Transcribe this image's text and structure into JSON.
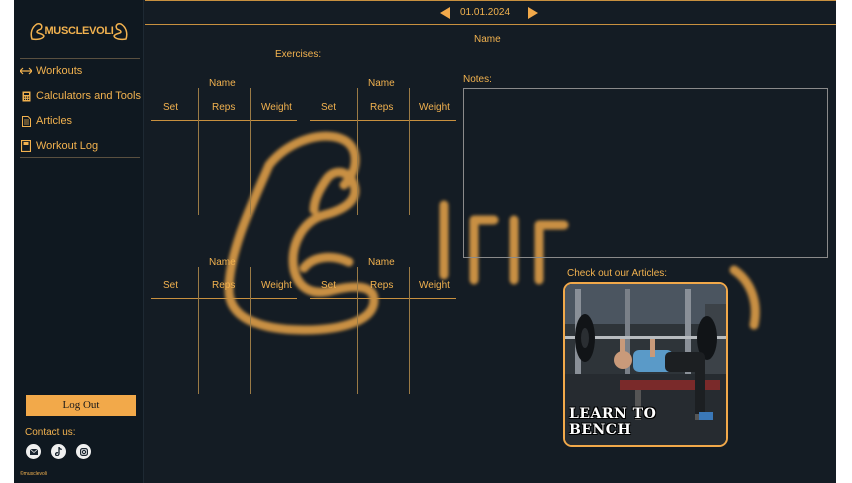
{
  "app": {
    "logo_text": "MUSCLEVOLI",
    "copyright": "©musclevoli"
  },
  "sidebar": {
    "items": [
      {
        "label": "Workouts",
        "icon": "arrows-icon"
      },
      {
        "label": "Calculators and Tools",
        "icon": "calculator-icon"
      },
      {
        "label": "Articles",
        "icon": "document-icon"
      },
      {
        "label": "Workout Log",
        "icon": "notebook-icon"
      }
    ],
    "logout_label": "Log Out",
    "contact_label": "Contact us:",
    "socials": [
      "mail-icon",
      "tiktok-icon",
      "instagram-icon"
    ]
  },
  "header": {
    "date": "01.01.2024"
  },
  "main": {
    "workout_name": "Name",
    "exercises_label": "Exercises:",
    "notes_label": "Notes:",
    "notes_value": "",
    "exercise_blocks": [
      {
        "name": "Name",
        "columns": [
          "Set",
          "Reps",
          "Weight"
        ]
      },
      {
        "name": "Name",
        "columns": [
          "Set",
          "Reps",
          "Weight"
        ]
      },
      {
        "name": "Name",
        "columns": [
          "Set",
          "Reps",
          "Weight"
        ]
      },
      {
        "name": "Name",
        "columns": [
          "Set",
          "Reps",
          "Weight"
        ]
      }
    ],
    "articles_label": "Check out our Articles:",
    "article_card": {
      "title_line1": "LEARN TO",
      "title_line2": "BENCH"
    }
  },
  "colors": {
    "accent": "#f2a94a",
    "background": "#141c24",
    "sidebar": "#0f1820"
  }
}
